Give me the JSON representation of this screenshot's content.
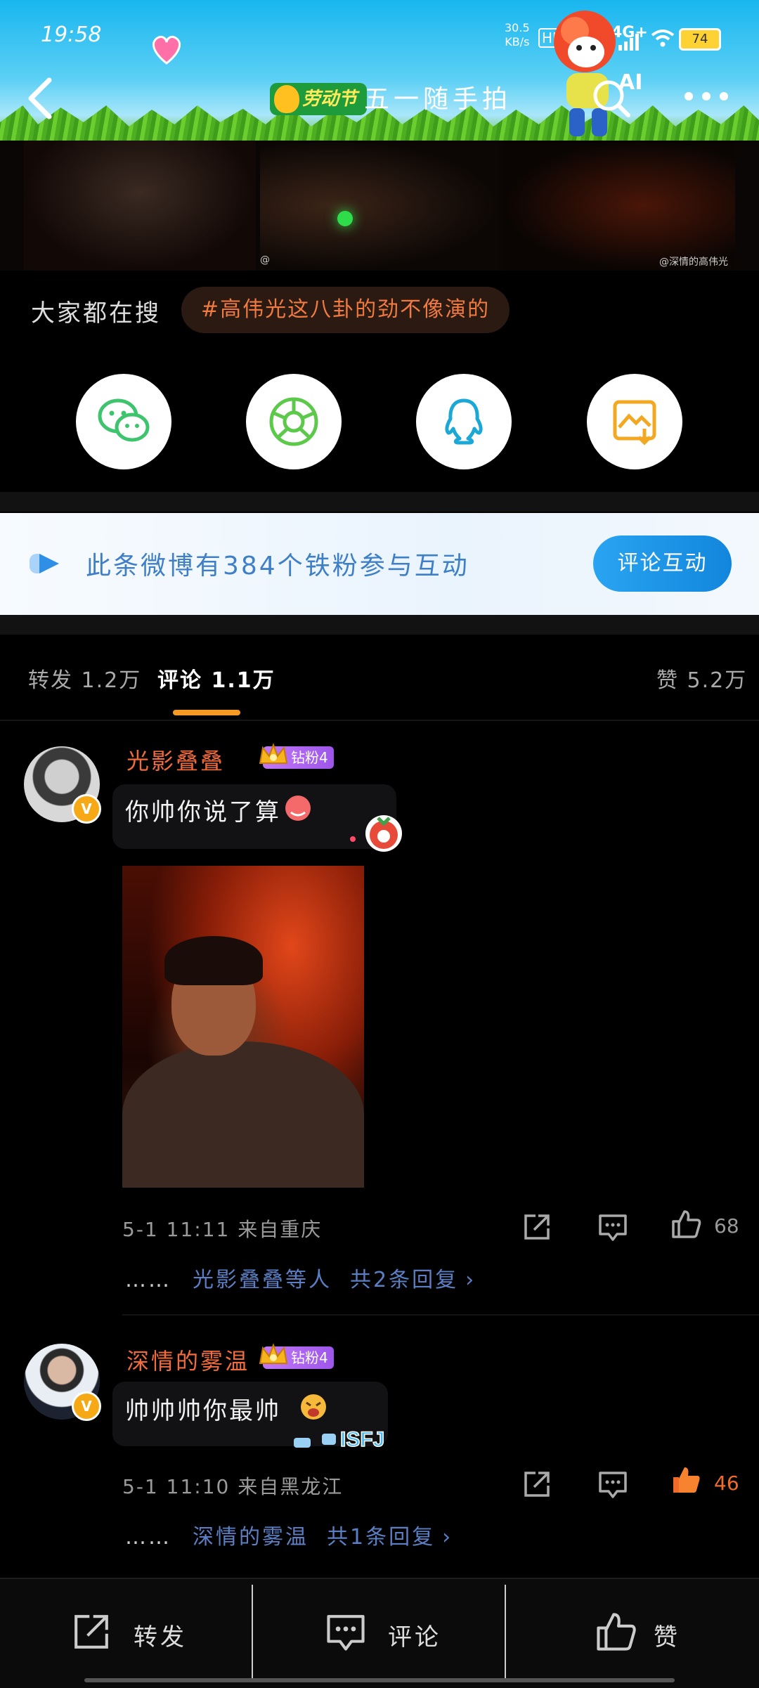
{
  "status_bar": {
    "time": "19:58",
    "net_speed_value": "30.5",
    "net_speed_unit": "KB/s",
    "hd": "HD",
    "network": "4G+",
    "battery": "74"
  },
  "header": {
    "badge_label": "劳动节",
    "title": "五一随手拍",
    "ai_label": "AI"
  },
  "images": {
    "watermark_2": "@",
    "watermark_3": "@深情的高伟光"
  },
  "search_row": {
    "label": "大家都在搜",
    "hot_topic": "#高伟光这八卦的劲不像演的"
  },
  "share": [
    {
      "name": "wechat-icon"
    },
    {
      "name": "moments-icon"
    },
    {
      "name": "qq-icon"
    },
    {
      "name": "save-image-icon"
    }
  ],
  "fans_banner": {
    "text": "此条微博有384个铁粉参与互动",
    "button": "评论互动"
  },
  "tabs": {
    "repost": "转发 1.2万",
    "comment": "评论 1.1万",
    "like": "赞 5.2万"
  },
  "comments": [
    {
      "username": "光影叠叠",
      "badge": "钻粉4",
      "text": "你帅你说了算",
      "meta": "5-1 11:11  来自重庆",
      "likes": "68",
      "liked": false,
      "reply_dots": "……",
      "reply_users": "光影叠叠等人",
      "reply_count": "共2条回复"
    },
    {
      "username": "深情的雾温",
      "badge": "钻粉4",
      "text": "帅帅帅你最帅",
      "meta": "5-1 11:10  来自黑龙江",
      "likes": "46",
      "liked": true,
      "reply_dots": "……",
      "reply_users": "深情的雾温",
      "reply_count": "共1条回复"
    }
  ],
  "bottom_bar": {
    "repost": "转发",
    "comment": "评论",
    "like": "赞"
  },
  "colors": {
    "accent_orange": "#f59a23",
    "username": "#f26b3a",
    "reply_link": "#5b7fc4",
    "fans_button": "#1a95e8"
  }
}
